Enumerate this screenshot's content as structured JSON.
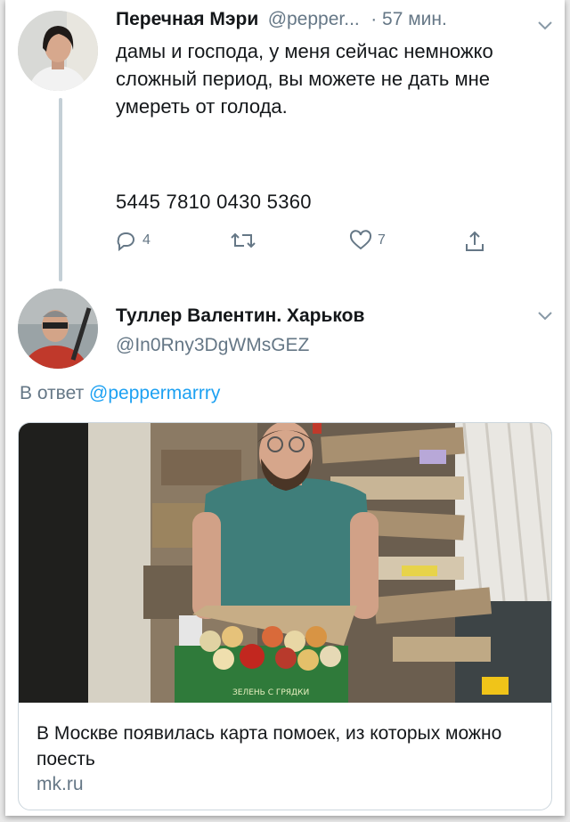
{
  "tweet1": {
    "author_name": "Перечная Мэри",
    "handle": "@pepper...",
    "time": "· 57 мин.",
    "text": "дамы и господа, у меня сейчас немножко сложный период, вы можете не дать мне умереть от голода.",
    "card_number": "5445 7810 0430 5360",
    "actions": {
      "reply_count": "4",
      "retweet_count": "",
      "like_count": "7"
    }
  },
  "tweet2": {
    "author_name": "Туллер Валентин. Харьков",
    "handle": "@In0Rny3DgWMsGEZ",
    "reply_prefix": "В ответ",
    "reply_to": "@peppermarrry",
    "card": {
      "image_box_text": "ЗЕЛЕНЬ С ГРЯДКИ",
      "title": "В Москве появилась карта помоек, из которых можно поесть",
      "domain": "mk.ru"
    }
  },
  "icons": [
    "chevron-down-icon",
    "reply-icon",
    "retweet-icon",
    "like-icon",
    "share-icon"
  ],
  "colors": {
    "link": "#1da1f2",
    "muted": "#657786",
    "thread": "#c4cfd6"
  }
}
